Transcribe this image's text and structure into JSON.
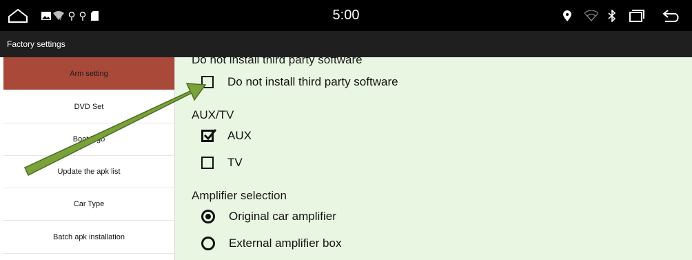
{
  "statusbar": {
    "time": "5:00",
    "icons_left": [
      "home-outline-icon",
      "image-icon",
      "wifi-question-icon",
      "usb-icon",
      "usb-icon",
      "sd-card-icon"
    ],
    "icons_right": [
      "location-pin-icon",
      "wifi-icon",
      "bluetooth-icon",
      "recent-apps-icon",
      "back-icon"
    ]
  },
  "titlebar": {
    "title": "Factory settings"
  },
  "sidebar": {
    "items": [
      {
        "label": "Arm setting",
        "active": true
      },
      {
        "label": "DVD Set",
        "active": false
      },
      {
        "label": "Boot logo",
        "active": false
      },
      {
        "label": "Update the apk list",
        "active": false
      },
      {
        "label": "Car Type",
        "active": false
      },
      {
        "label": "Batch apk installation",
        "active": false
      }
    ]
  },
  "content": {
    "section_software": {
      "title": "Do not install third party software",
      "option_label": "Do not install third party software",
      "checked": false
    },
    "section_auxtv": {
      "title": "AUX/TV",
      "options": [
        {
          "label": "AUX",
          "checked": true
        },
        {
          "label": "TV",
          "checked": false
        }
      ]
    },
    "section_amp": {
      "title": "Amplifier selection",
      "options": [
        {
          "label": "Original car amplifier",
          "selected": true
        },
        {
          "label": "External amplifier box",
          "selected": false
        }
      ]
    }
  },
  "colors": {
    "active_item_bg": "#a9493a",
    "content_bg": "#e9f7e2",
    "arrow_fill": "#7aa13a"
  }
}
